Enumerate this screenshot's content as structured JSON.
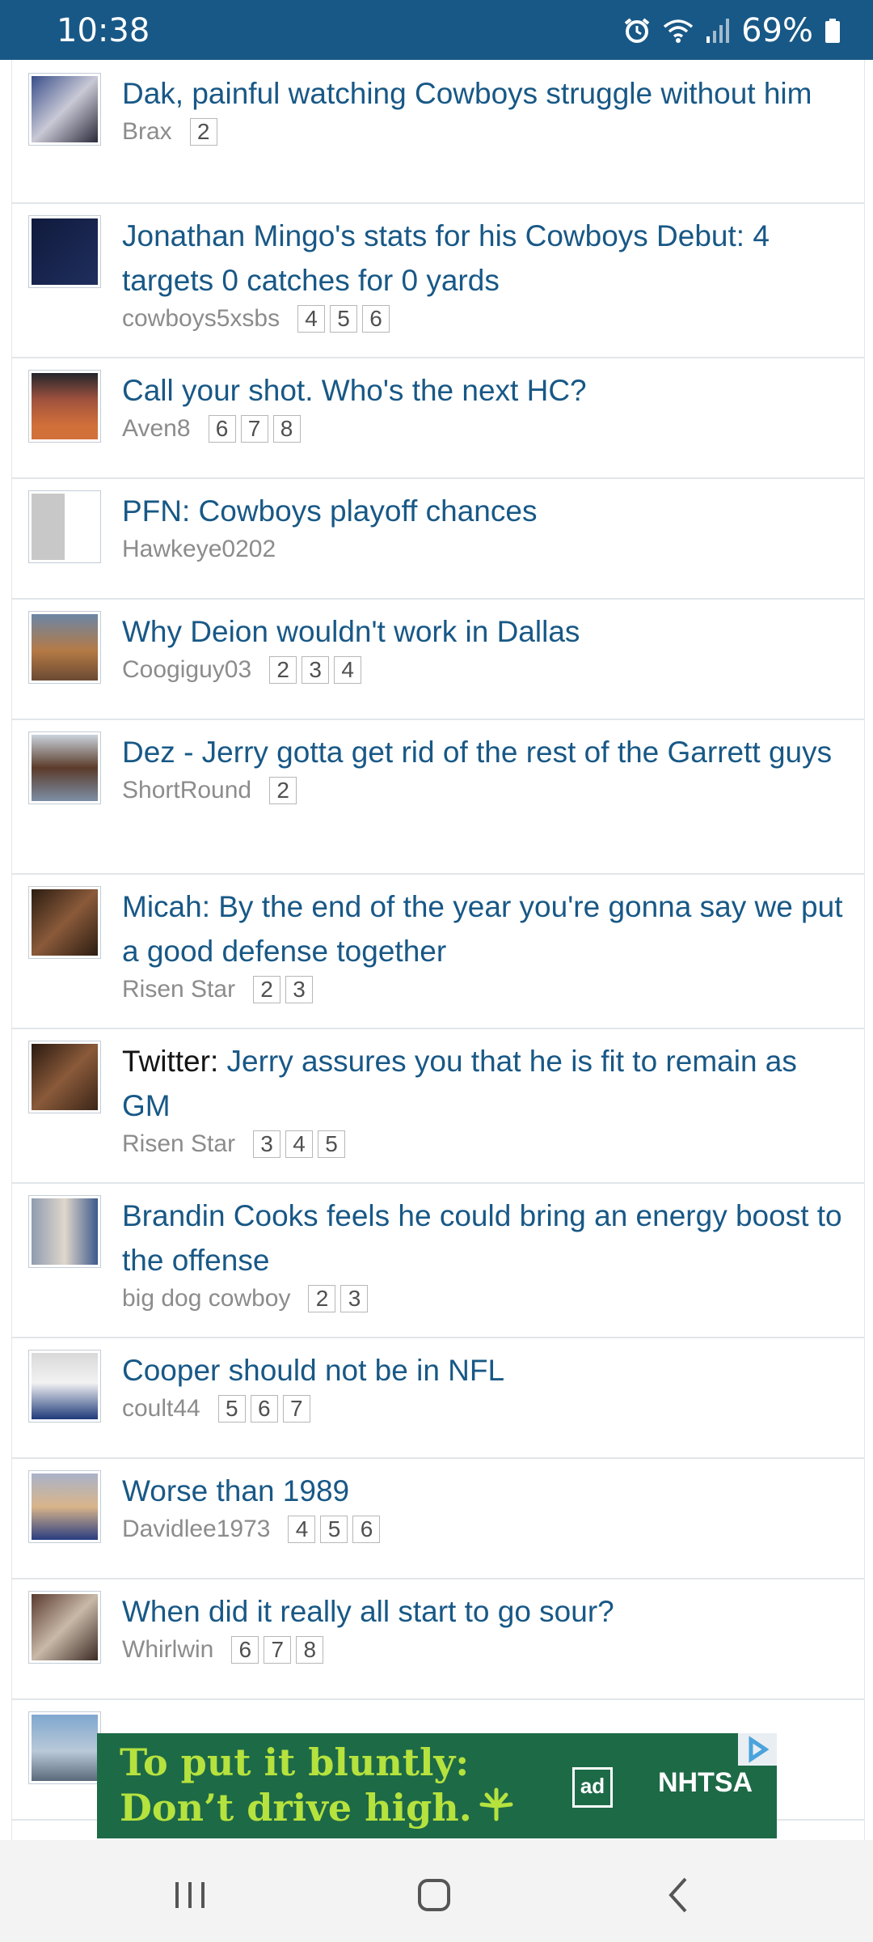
{
  "status": {
    "time": "10:38",
    "battery": "69%",
    "icons": [
      "alarm-icon",
      "wifi-icon",
      "signal-icon",
      "battery-icon"
    ]
  },
  "threads": [
    {
      "prefix": "",
      "title": "Dak, painful watching Cowboys struggle without him",
      "author": "Brax",
      "pages": [
        "2"
      ]
    },
    {
      "prefix": "",
      "title": "Jonathan Mingo's stats for his Cowboys Debut: 4 targets 0 catches for 0 yards",
      "author": "cowboys5xsbs",
      "pages": [
        "4",
        "5",
        "6"
      ]
    },
    {
      "prefix": "",
      "title": "Call your shot. Who's the next HC?",
      "author": "Aven8",
      "pages": [
        "6",
        "7",
        "8"
      ]
    },
    {
      "prefix": "",
      "title": "PFN: Cowboys playoff chances",
      "author": "Hawkeye0202",
      "pages": []
    },
    {
      "prefix": "",
      "title": "Why Deion wouldn't work in Dallas",
      "author": "Coogiguy03",
      "pages": [
        "2",
        "3",
        "4"
      ]
    },
    {
      "prefix": "",
      "title": "Dez - Jerry gotta get rid of the rest of the Garrett guys",
      "author": "ShortRound",
      "pages": [
        "2"
      ]
    },
    {
      "prefix": "",
      "title": "Micah: By the end of the year you're gonna say we put a good defense together",
      "author": "Risen Star",
      "pages": [
        "2",
        "3"
      ]
    },
    {
      "prefix": "Twitter:",
      "title": "Jerry assures you that he is fit to remain as GM",
      "author": "Risen Star",
      "pages": [
        "3",
        "4",
        "5"
      ]
    },
    {
      "prefix": "",
      "title": "Brandin Cooks feels he could bring an energy boost to the offense",
      "author": "big dog cowboy",
      "pages": [
        "2",
        "3"
      ]
    },
    {
      "prefix": "",
      "title": "Cooper should not be in NFL",
      "author": "coult44",
      "pages": [
        "5",
        "6",
        "7"
      ]
    },
    {
      "prefix": "",
      "title": "Worse than 1989",
      "author": "Davidlee1973",
      "pages": [
        "4",
        "5",
        "6"
      ]
    },
    {
      "prefix": "",
      "title": "When did it really all start to go sour?",
      "author": "Whirlwin",
      "pages": [
        "6",
        "7",
        "8"
      ]
    }
  ],
  "ad": {
    "line1": "To put it bluntly:",
    "line2": "Don’t drive high.",
    "logo1": "ad",
    "logo2": "NHTSA"
  },
  "colors": {
    "header": "#185886",
    "link": "#185886",
    "ad_bg": "#1d6a47",
    "ad_text": "#b6e23e"
  }
}
